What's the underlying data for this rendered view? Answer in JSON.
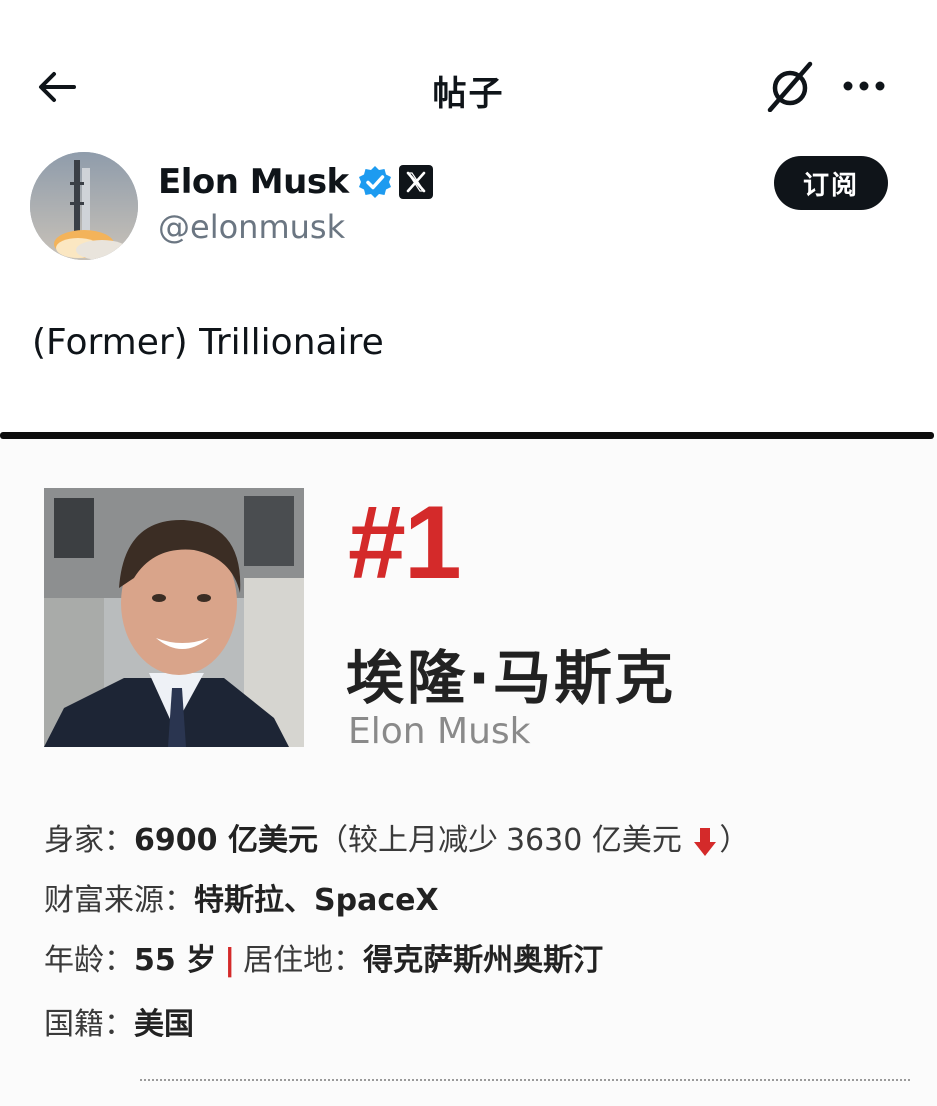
{
  "header": {
    "title": "帖子",
    "back_icon": "arrow-left-icon",
    "grok_icon": "grok-icon",
    "more_icon": "more-horizontal-icon"
  },
  "post": {
    "author": {
      "display_name": "Elon Musk",
      "handle": "@elonmusk",
      "verified_icon": "verified-badge-icon",
      "affiliate_icon": "x-logo-icon"
    },
    "subscribe_label": "订阅",
    "text": "(Former) Trillionaire"
  },
  "card": {
    "rank": "#1",
    "name_cn": "埃隆·马斯克",
    "name_en": "Elon Musk",
    "net_worth": {
      "label": "身家：",
      "value": "6900 亿美元",
      "change_open": "（较上月减少",
      "change_value": "3630 亿美元",
      "change_close": "）"
    },
    "wealth_source": {
      "label": "财富来源：",
      "value": "特斯拉、SpaceX"
    },
    "age": {
      "label": "年龄：",
      "value": "55 岁"
    },
    "separator": "|",
    "residence": {
      "label": "居住地：",
      "value": "得克萨斯州奥斯汀"
    },
    "nationality": {
      "label": "国籍：",
      "value": "美国"
    }
  },
  "colors": {
    "accent_red": "#d42a2a",
    "verified_blue": "#1d9bf0",
    "text_dark": "#0f1419",
    "text_gray": "#6b7682"
  }
}
